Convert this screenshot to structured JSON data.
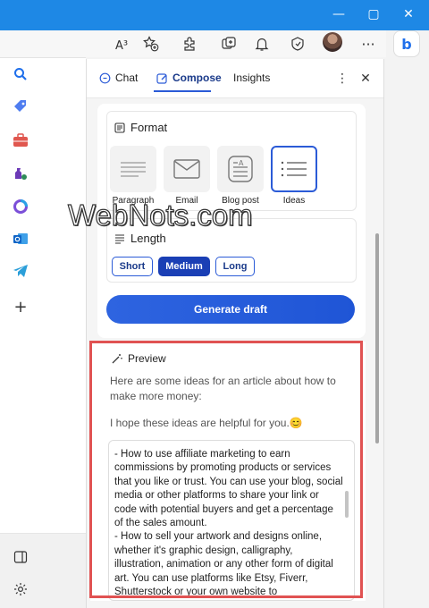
{
  "window": {
    "minimize": "—",
    "maximize": "▢",
    "close": "✕"
  },
  "toolbar": {
    "read_aloud": "A³",
    "icons": [
      "read-aloud-icon",
      "add-favorite-icon",
      "extensions-icon",
      "collections-icon",
      "notifications-icon",
      "performance-icon",
      "profile-avatar",
      "more-icon"
    ]
  },
  "sidebar_panel": {
    "tabs": [
      {
        "label": "Chat",
        "icon": "chat-icon"
      },
      {
        "label": "Compose",
        "icon": "compose-icon",
        "active": true
      },
      {
        "label": "Insights"
      }
    ],
    "more": "⋮",
    "close": "✕",
    "format": {
      "title": "Format",
      "options": [
        {
          "label": "Paragraph",
          "icon": "paragraph-icon"
        },
        {
          "label": "Email",
          "icon": "email-icon"
        },
        {
          "label": "Blog post",
          "icon": "blog-post-icon"
        },
        {
          "label": "Ideas",
          "icon": "ideas-icon",
          "selected": true
        }
      ]
    },
    "length": {
      "title": "Length",
      "options": [
        {
          "label": "Short"
        },
        {
          "label": "Medium",
          "selected": true
        },
        {
          "label": "Long"
        }
      ]
    },
    "generate_label": "Generate draft",
    "preview": {
      "title": "Preview",
      "intro": "Here are some ideas for an article about how to make more money:",
      "closing": "I hope these ideas are helpful for you.😊",
      "draft_text": "- How to use affiliate marketing to earn commissions by promoting products or services that you like or trust. You can use your blog, social media or other platforms to share your link or code with potential buyers and get a percentage of the sales amount.\n- How to sell your artwork and designs online, whether it's graphic design, calligraphy, illustration, animation or any other form of digital art. You can use platforms like Etsy, Fiverr, Shutterstock or your own website to"
    }
  },
  "right_rail": {
    "bing": "b",
    "icons": [
      "search-icon",
      "shopping-tag-icon",
      "tools-briefcase-icon",
      "games-icon",
      "office-icon",
      "outlook-icon",
      "telegram-icon",
      "add-icon",
      "sidebar-toggle-icon",
      "settings-icon"
    ],
    "add": "+"
  },
  "watermark": "WebNots.com",
  "colors": {
    "accent": "#2b5bd7",
    "titlebar": "#1e88e5",
    "highlight_frame": "#e05252"
  }
}
